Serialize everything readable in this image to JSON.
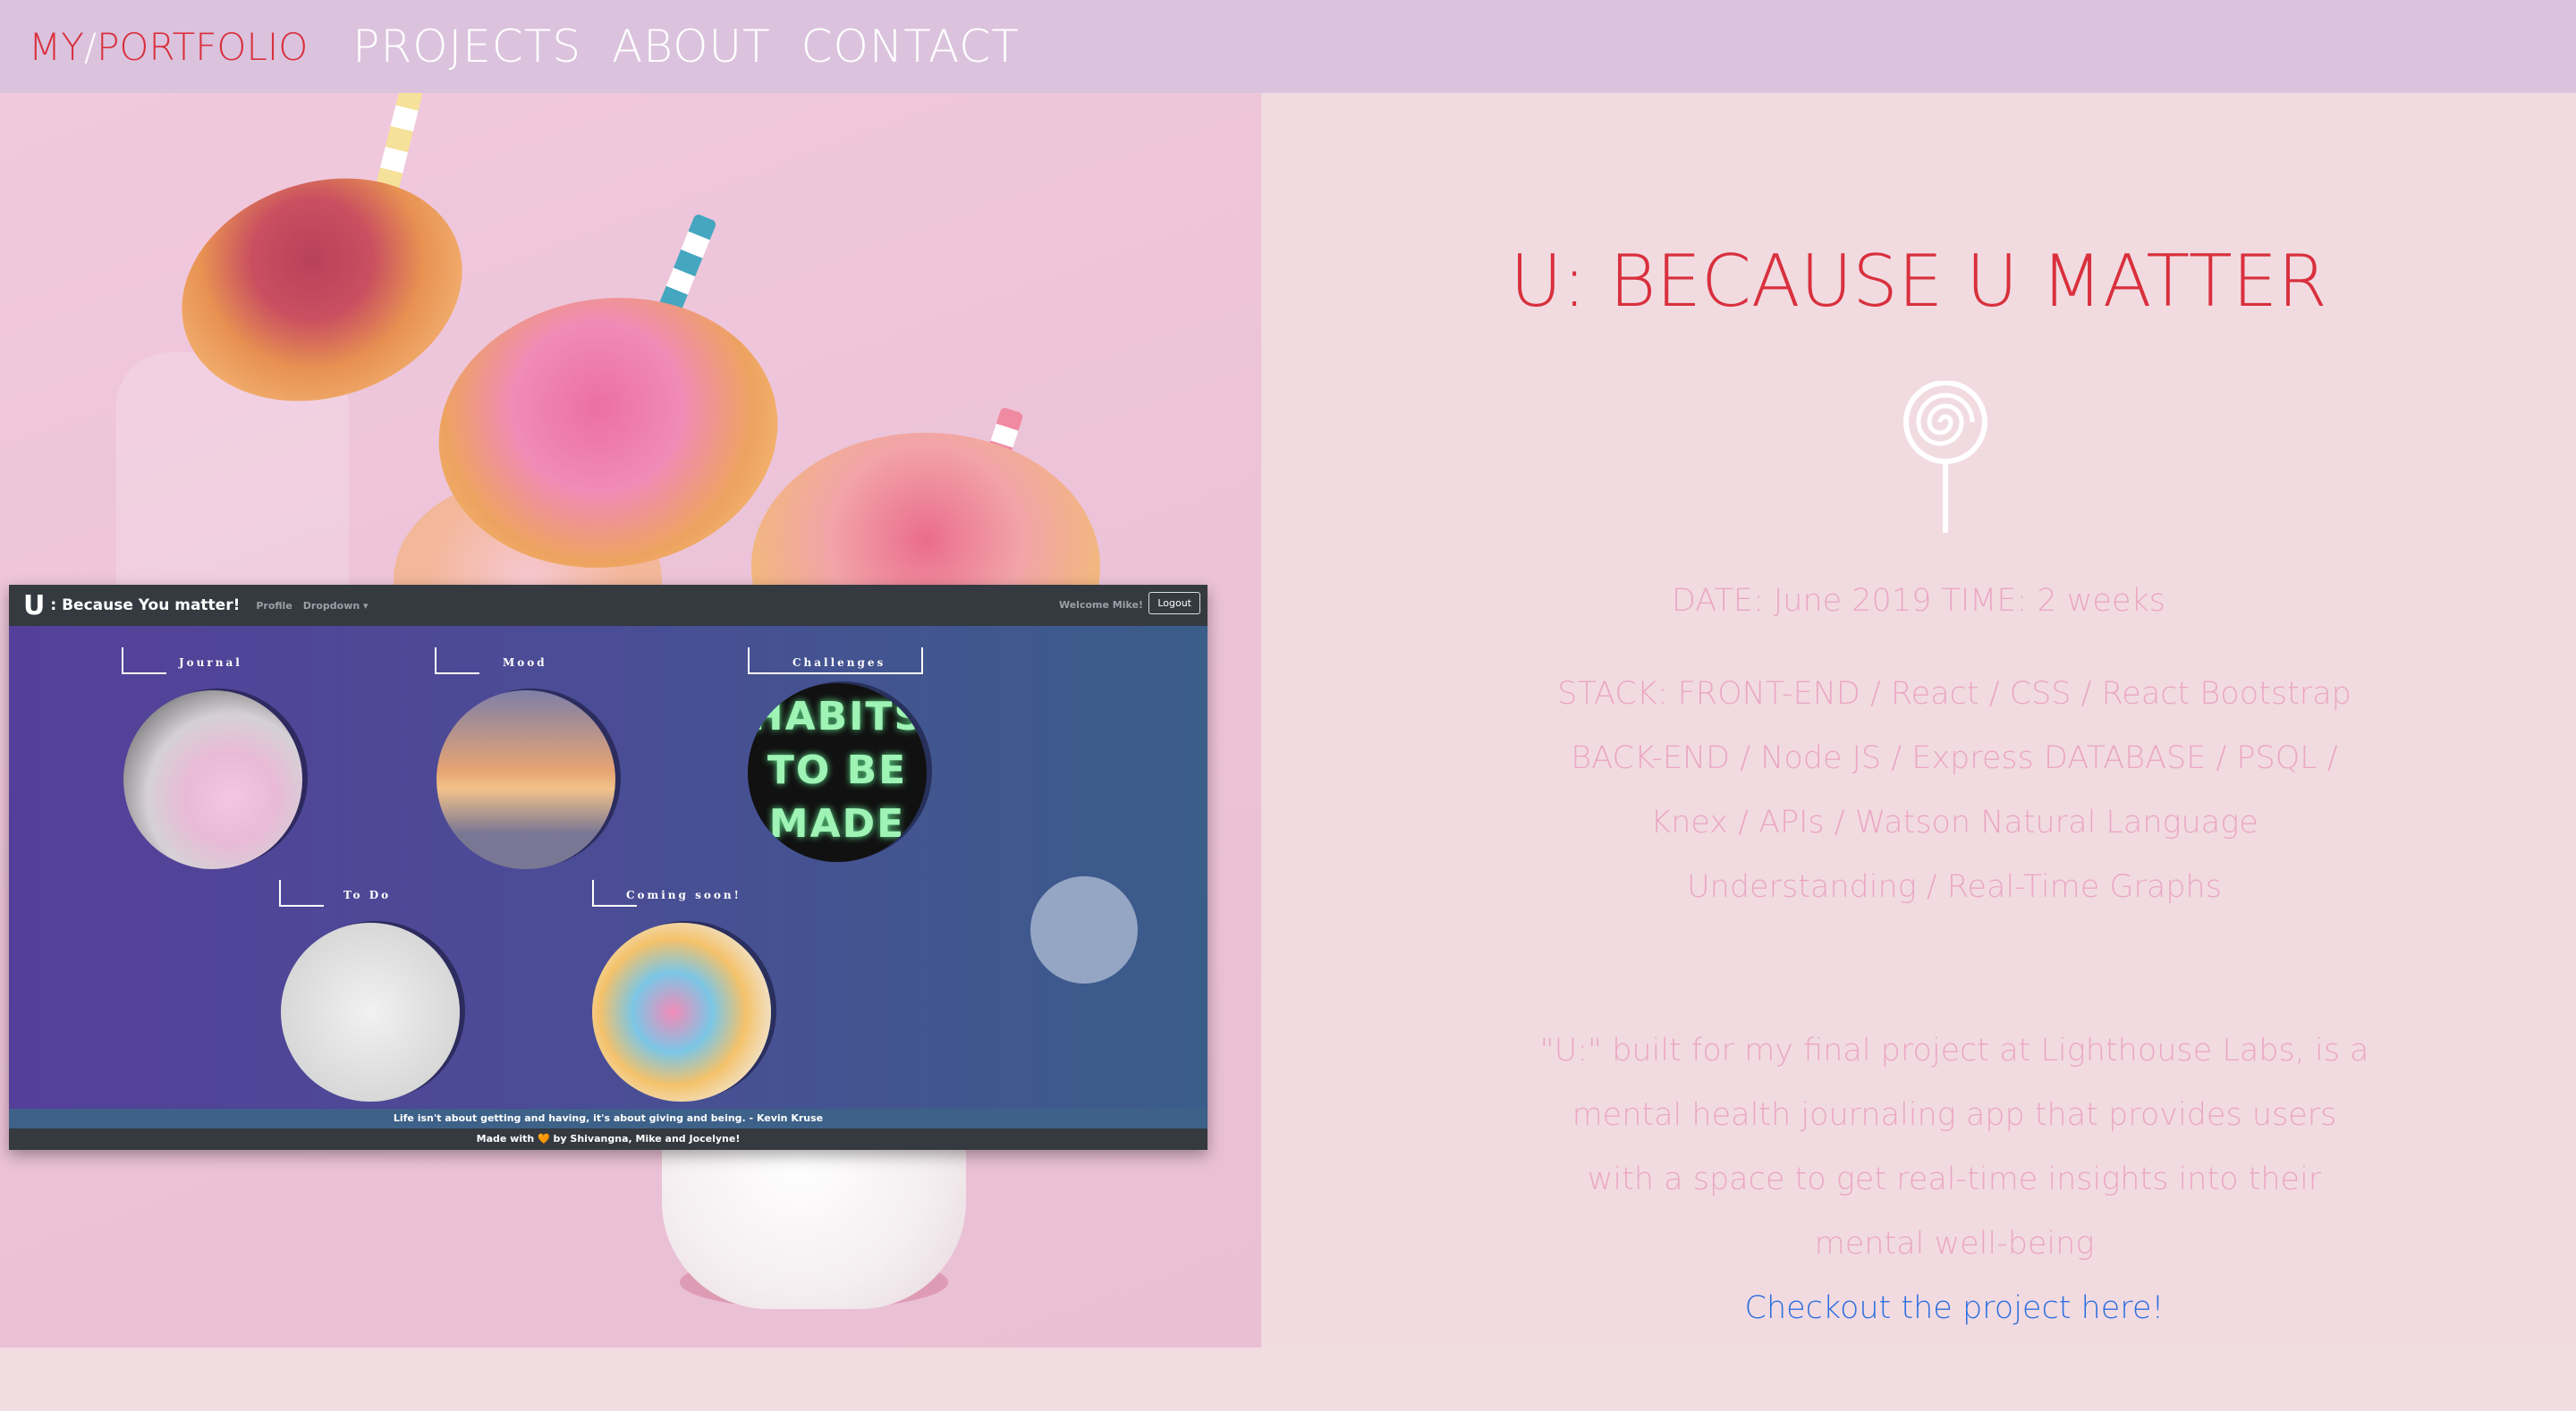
{
  "nav": {
    "brand_my": "MY",
    "brand_slash": "/",
    "brand_portfolio": "PORTFOLIO",
    "links": [
      "PROJECTS",
      "ABOUT",
      "CONTACT"
    ]
  },
  "app_screenshot": {
    "logo": "U",
    "title": ": Because You matter!",
    "nav_links": [
      "Profile",
      "Dropdown ▾"
    ],
    "welcome": "Welcome Mike!",
    "logout": "Logout",
    "cards": [
      "Journal",
      "Mood",
      "Challenges",
      "To Do",
      "Coming soon!"
    ],
    "neon_text": "HABITS TO BE MADE",
    "quote": "Life isn't about getting and having, it's about giving and being. - Kevin Kruse",
    "footer": "Made with 🧡 by Shivangna, Mike and Jocelyne!"
  },
  "project": {
    "title": "U: BECAUSE U MATTER",
    "date_line": "DATE: June 2019 TIME: 2 weeks",
    "stack": "STACK: FRONT-END / React / CSS / React Bootstrap BACK-END / Node JS / Express DATABASE / PSQL / Knex / APIs / Watson Natural Language Understanding / Real-Time Graphs",
    "description": "\"U:\" built for my final project at Lighthouse Labs, is a mental health journaling app that provides users with a space to get real-time insights into their mental well-being",
    "link_text": "Checkout the project here!"
  },
  "colors": {
    "accent_red": "#d9303d",
    "nav_bg": "#dbc3de",
    "text_pink": "#eba7c4",
    "link_blue": "#2f6fde"
  },
  "icons": {
    "lollipop": "lollipop-icon"
  }
}
